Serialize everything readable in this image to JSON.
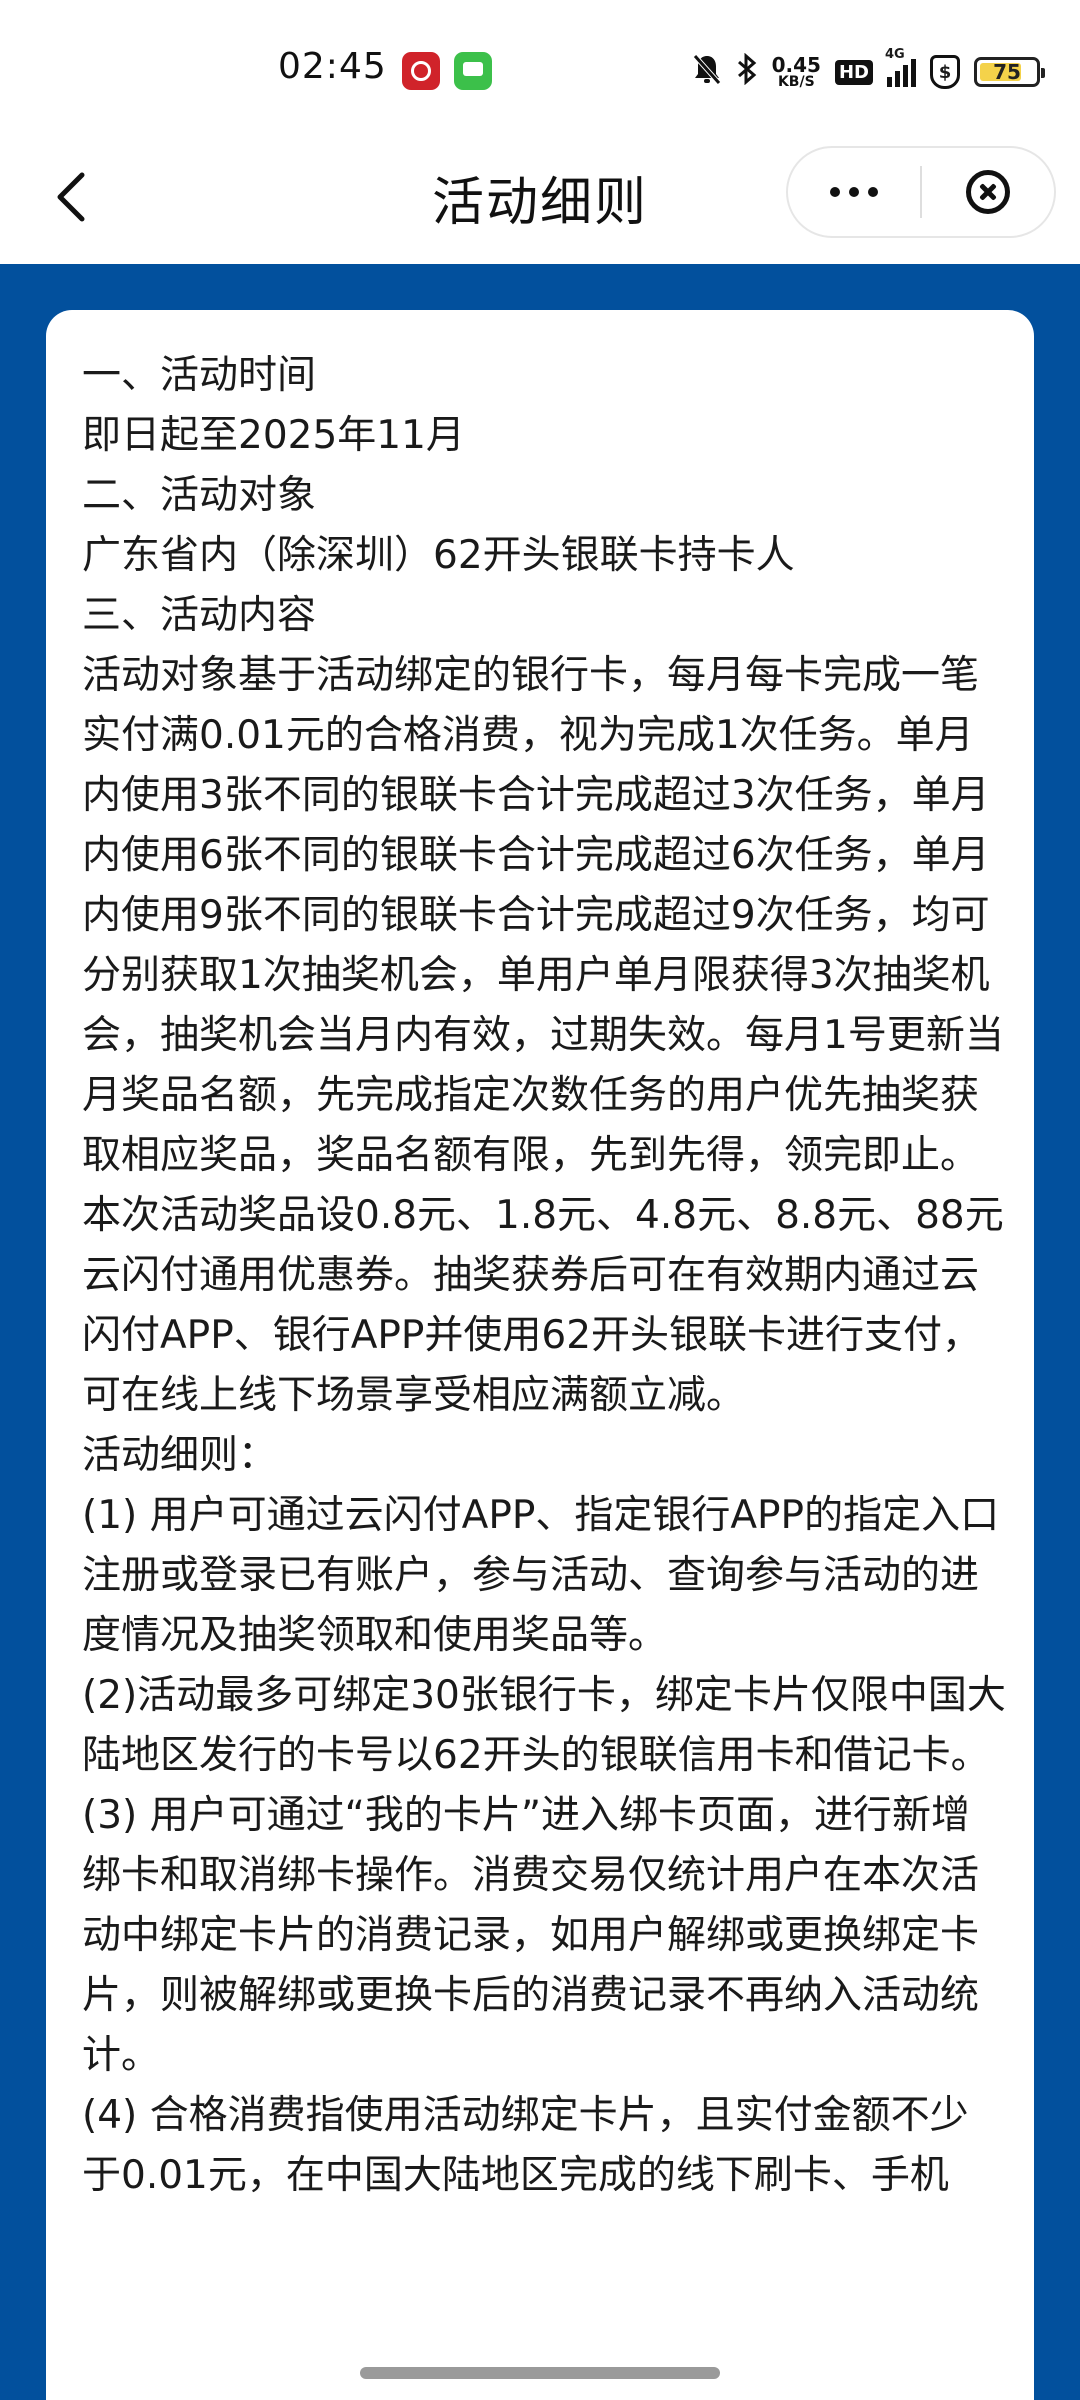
{
  "status_bar": {
    "time": "02:45",
    "net_speed_value": "0.45",
    "net_speed_unit": "KB/S",
    "hd_label": "HD",
    "network_label": "4G",
    "shield_label": "$",
    "battery_level": "75",
    "battery_fill_fraction": 0.75,
    "app_icons": [
      "unionpay-icon",
      "message-icon"
    ],
    "system_icons": [
      "mute-bell-icon",
      "bluetooth-icon",
      "signal-icon",
      "shield-icon",
      "battery-icon"
    ]
  },
  "nav": {
    "title": "活动细则",
    "icons": [
      "back-chevron-icon",
      "more-dots-icon",
      "close-circle-icon"
    ]
  },
  "rules": {
    "lines": [
      "一、活动时间",
      "即日起至2025年11月",
      "二、活动对象",
      "广东省内（除深圳）62开头银联卡持卡人",
      "三、活动内容",
      "活动对象基于活动绑定的银行卡，每月每卡完成一笔实付满0.01元的合格消费，视为完成1次任务。单月内使用3张不同的银联卡合计完成超过3次任务，单月内使用6张不同的银联卡合计完成超过6次任务，单月内使用9张不同的银联卡合计完成超过9次任务，均可分别获取1次抽奖机会，单用户单月限获得3次抽奖机会，抽奖机会当月内有效，过期失效。每月1号更新当月奖品名额，先完成指定次数任务的用户优先抽奖获取相应奖品，奖品名额有限，先到先得，领完即止。本次活动奖品设0.8元、1.8元、4.8元、8.8元、88元云闪付通用优惠券。抽奖获券后可在有效期内通过云闪付APP、银行APP并使用62开头银联卡进行支付，可在线上线下场景享受相应满额立减。",
      "活动细则：",
      "(1) 用户可通过云闪付APP、指定银行APP的指定入口注册或登录已有账户，参与活动、查询参与活动的进度情况及抽奖领取和使用奖品等。",
      "(2)活动最多可绑定30张银行卡，绑定卡片仅限中国大陆地区发行的卡号以62开头的银联信用卡和借记卡。",
      "(3) 用户可通过“我的卡片”进入绑卡页面，进行新增绑卡和取消绑卡操作。消费交易仅统计用户在本次活动中绑定卡片的消费记录，如用户解绑或更换绑定卡片，则被解绑或更换卡后的消费记录不再纳入活动统计。",
      "(4) 合格消费指使用活动绑定卡片，且实付金额不少于0.01元，在中国大陆地区完成的线下刷卡、手机"
    ]
  }
}
